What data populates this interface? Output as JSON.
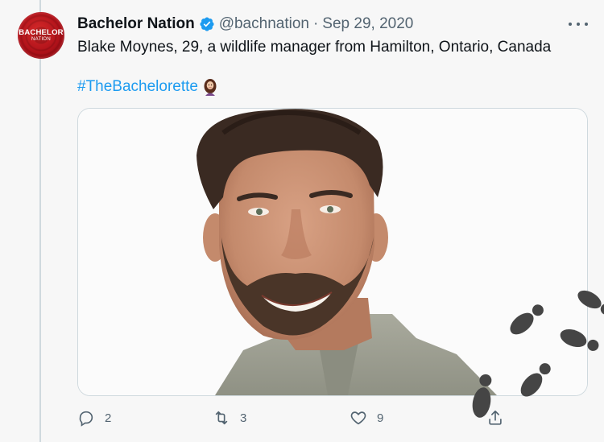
{
  "tweet": {
    "avatar": {
      "brand_top": "BACHELOR",
      "brand_bottom": "NATION"
    },
    "display_name": "Bachelor Nation",
    "verified_icon": "verified-badge-icon",
    "handle": "@bachnation",
    "separator": "·",
    "date": "Sep 29, 2020",
    "more_icon": "more-options-icon",
    "text": "Blake Moynes, 29, a wildlife manager from Hamilton, Ontario, Canada",
    "hashtag": "#TheBachelorette",
    "hashtag_emoji_icon": "woman-emoji-icon",
    "media": {
      "icon": "photo-of-man-icon"
    },
    "actions": {
      "reply": {
        "icon": "reply-icon",
        "count": "2"
      },
      "retweet": {
        "icon": "retweet-icon",
        "count": "3"
      },
      "like": {
        "icon": "heart-icon",
        "count": "9"
      },
      "share": {
        "icon": "share-icon"
      }
    }
  },
  "overlay": {
    "icon": "footprints-icon"
  },
  "colors": {
    "link": "#1d9bf0",
    "secondary_text": "#536471",
    "verified": "#1d9bf0",
    "avatar_red": "#b0121a",
    "background": "#f7f7f7"
  }
}
